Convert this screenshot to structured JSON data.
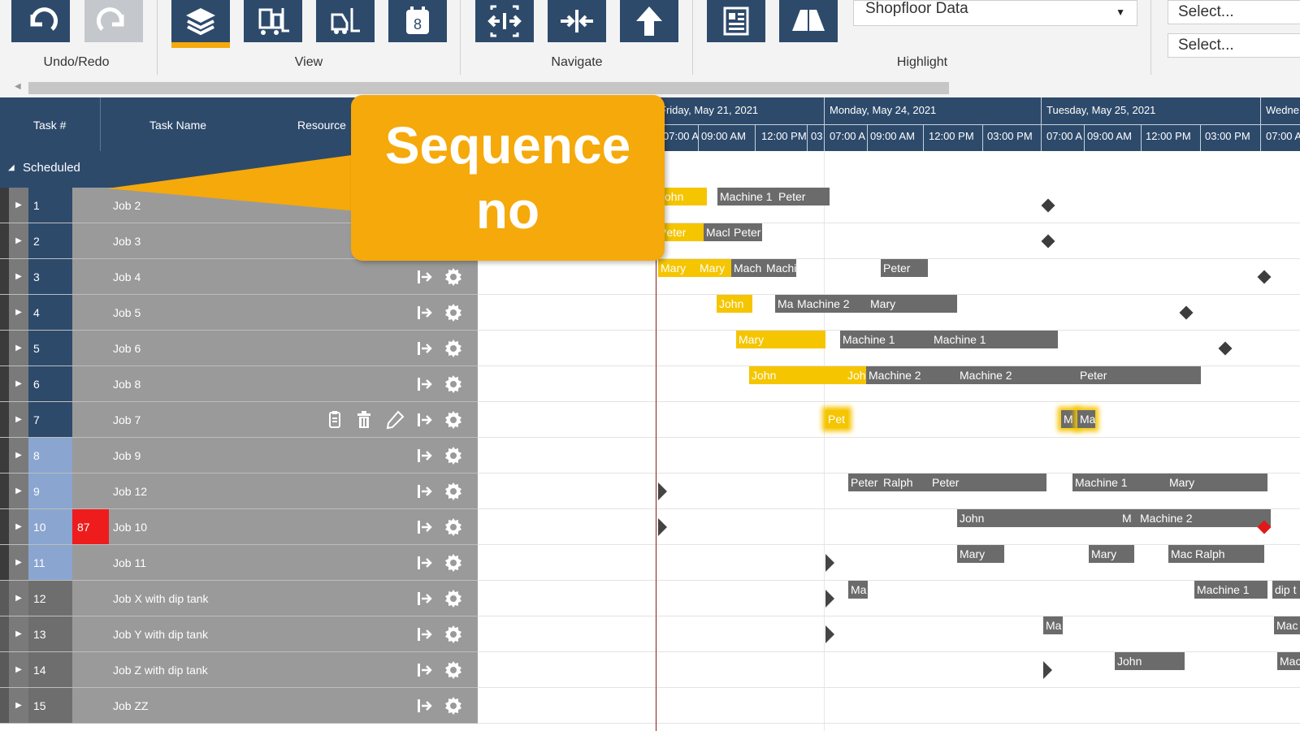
{
  "ribbon": {
    "groups": {
      "undo_redo": "Undo/Redo",
      "view": "View",
      "navigate": "Navigate",
      "highlight": "Highlight"
    },
    "highlight_combo": "Shopfloor Data",
    "selects": [
      "Select...",
      "Select..."
    ],
    "calendar_day": "8"
  },
  "grid": {
    "headers": {
      "task_num": "Task #",
      "task_name": "Task Name",
      "resource": "Resource"
    },
    "group_label": "Scheduled",
    "rows": [
      {
        "num": "1",
        "seq": "",
        "name": "Job 2"
      },
      {
        "num": "2",
        "seq": "",
        "name": "Job 3"
      },
      {
        "num": "3",
        "seq": "",
        "name": "Job 4"
      },
      {
        "num": "4",
        "seq": "",
        "name": "Job 5"
      },
      {
        "num": "5",
        "seq": "",
        "name": "Job 6"
      },
      {
        "num": "6",
        "seq": "",
        "name": "Job 8"
      },
      {
        "num": "7",
        "seq": "",
        "name": "Job 7"
      },
      {
        "num": "8",
        "seq": "",
        "name": "Job 9"
      },
      {
        "num": "9",
        "seq": "",
        "name": "Job 12"
      },
      {
        "num": "10",
        "seq": "87",
        "name": "Job 10"
      },
      {
        "num": "11",
        "seq": "",
        "name": "Job 11"
      },
      {
        "num": "12",
        "seq": "",
        "name": "Job X with dip tank"
      },
      {
        "num": "13",
        "seq": "",
        "name": "Job Y with dip tank"
      },
      {
        "num": "14",
        "seq": "",
        "name": "Job Z with dip tank"
      },
      {
        "num": "15",
        "seq": "",
        "name": "Job ZZ"
      }
    ]
  },
  "timeline": {
    "days": [
      "Friday, May 21, 2021",
      "Monday, May 24, 2021",
      "Tuesday, May 25, 2021",
      "Wedne"
    ],
    "hours": [
      "07:00 A",
      "09:00 AM",
      "12:00 PM",
      "03",
      "07:00 A",
      "09:00 AM",
      "12:00 PM",
      "03:00 PM",
      "07:00 A",
      "09:00 AM",
      "12:00 PM",
      "03:00 PM",
      "07:00 A"
    ]
  },
  "bars": {
    "r1": [
      "John",
      "Machine 1",
      "Peter"
    ],
    "r2": [
      "Peter",
      "Macl",
      "Peter"
    ],
    "r3": [
      "Mary",
      "Mary",
      "Mach",
      "Machi",
      "Peter"
    ],
    "r4": [
      "John",
      "Ma",
      "Machine 2",
      "Mary"
    ],
    "r5": [
      "Mary",
      "Machine 1",
      "Machine 1"
    ],
    "r6": [
      "John",
      "Joh",
      "Machine 2",
      "Machine 2",
      "Peter"
    ],
    "r7": [
      "Pet",
      "M",
      "Ma"
    ],
    "r9": [
      "Peter",
      "Ralph",
      "Peter",
      "Machine 1",
      "Mary"
    ],
    "r10": [
      "John",
      "M",
      "Machine 2"
    ],
    "r11": [
      "Mary",
      "Mary",
      "Mac",
      "Ralph"
    ],
    "r12": [
      "Ma",
      "Machine 1",
      "dip t"
    ],
    "r13": [
      "Ma",
      "Mac"
    ],
    "r14": [
      "John",
      "Mac"
    ]
  },
  "callout": {
    "line1": "Sequence",
    "line2": "no"
  },
  "colors": {
    "navy": "#2d4a6b",
    "accent": "#f5a90b",
    "bar_yellow": "#f5c500",
    "bar_gray": "#6b6b6b",
    "red": "#ee1c1c"
  }
}
